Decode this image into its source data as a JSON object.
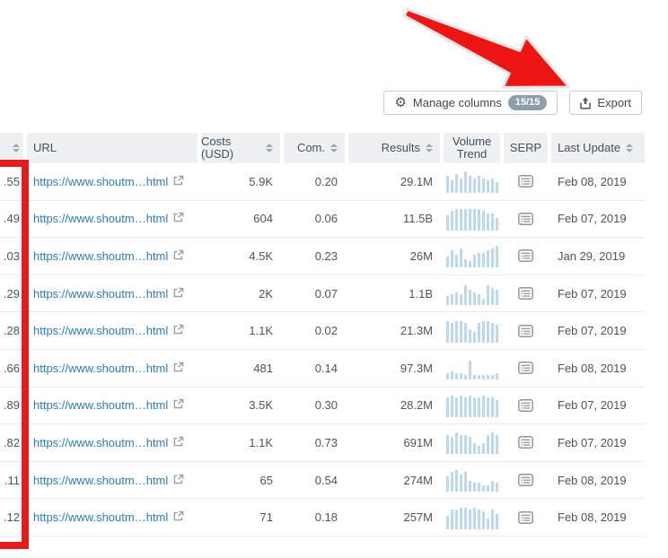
{
  "toolbar": {
    "manage_columns_label": "Manage columns",
    "columns_badge": "15/15",
    "export_label": "Export"
  },
  "table": {
    "headers": {
      "first": "",
      "url": "URL",
      "costs": "Costs (USD)",
      "com": "Com.",
      "results": "Results",
      "volume_trend": "Volume Trend",
      "serp": "SERP",
      "last_update": "Last Update"
    },
    "rows": [
      {
        "partial": ".55",
        "url": "https://www.shoutm…html",
        "costs": "5.9K",
        "com": "0.20",
        "results": "29.1M",
        "trend": [
          8,
          6,
          9,
          7,
          10,
          8,
          7,
          8,
          7,
          6,
          7,
          5
        ],
        "last_update": "Feb 08, 2019"
      },
      {
        "partial": ".49",
        "url": "https://www.shoutm…html",
        "costs": "604",
        "com": "0.06",
        "results": "11.5B",
        "trend": [
          7,
          9,
          10,
          10,
          10,
          10,
          10,
          10,
          9,
          8,
          8,
          6
        ],
        "last_update": "Feb 07, 2019"
      },
      {
        "partial": ".03",
        "url": "https://www.shoutm…html",
        "costs": "4.5K",
        "com": "0.23",
        "results": "26M",
        "trend": [
          5,
          8,
          6,
          9,
          4,
          3,
          6,
          7,
          7,
          8,
          9,
          10
        ],
        "last_update": "Jan 29, 2019"
      },
      {
        "partial": ".29",
        "url": "https://www.shoutm…html",
        "costs": "2K",
        "com": "0.07",
        "results": "1.1B",
        "trend": [
          4,
          5,
          6,
          5,
          9,
          7,
          6,
          5,
          3,
          9,
          8,
          7
        ],
        "last_update": "Feb 07, 2019"
      },
      {
        "partial": ".28",
        "url": "https://www.shoutm…html",
        "costs": "1.1K",
        "com": "0.02",
        "results": "21.3M",
        "trend": [
          10,
          9,
          10,
          10,
          9,
          6,
          5,
          9,
          10,
          10,
          9,
          8
        ],
        "last_update": "Feb 07, 2019"
      },
      {
        "partial": ".66",
        "url": "https://www.shoutm…html",
        "costs": "481",
        "com": "0.14",
        "results": "97.3M",
        "trend": [
          3,
          4,
          3,
          3,
          2,
          9,
          2,
          2,
          2,
          2,
          2,
          3
        ],
        "last_update": "Feb 08, 2019"
      },
      {
        "partial": ".89",
        "url": "https://www.shoutm…html",
        "costs": "3.5K",
        "com": "0.30",
        "results": "28.2M",
        "trend": [
          9,
          10,
          9,
          10,
          9,
          10,
          9,
          9,
          10,
          9,
          9,
          8
        ],
        "last_update": "Feb 07, 2019"
      },
      {
        "partial": ".82",
        "url": "https://www.shoutm…html",
        "costs": "1.1K",
        "com": "0.73",
        "results": "691M",
        "trend": [
          9,
          8,
          10,
          9,
          9,
          8,
          5,
          4,
          5,
          9,
          10,
          9
        ],
        "last_update": "Feb 07, 2019"
      },
      {
        "partial": ".11",
        "url": "https://www.shoutm…html",
        "costs": "65",
        "com": "0.54",
        "results": "274M",
        "trend": [
          7,
          9,
          10,
          8,
          9,
          5,
          4,
          4,
          3,
          3,
          5,
          4
        ],
        "last_update": "Feb 08, 2019"
      },
      {
        "partial": ".12",
        "url": "https://www.shoutm…html",
        "costs": "71",
        "com": "0.18",
        "results": "257M",
        "trend": [
          6,
          9,
          9,
          10,
          10,
          9,
          10,
          9,
          8,
          5,
          9,
          7
        ],
        "last_update": "Feb 08, 2019"
      }
    ]
  },
  "colors": {
    "annotation_red": "#e11d1d",
    "link_blue": "#2d7bc1",
    "trend_bar_blue": "#bdd9f0",
    "badge_gray": "#8d9faa",
    "header_gray": "#eef0f2"
  }
}
